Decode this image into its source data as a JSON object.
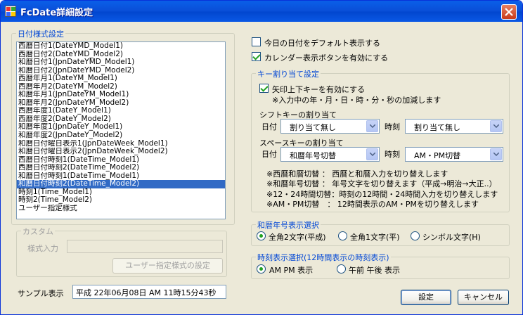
{
  "window": {
    "title": "FcDate詳細設定"
  },
  "format_group": {
    "label": "日付様式設定",
    "items": [
      "西暦日付1(DateYMD_Model1)",
      "西暦日付2(DateYMD_Model2)",
      "和暦日付1(JpnDateYMD_Model1)",
      "和暦日付2(JpnDateYMD_Model2)",
      "西暦年月1(DateYM_Model1)",
      "西暦年月2(DateYM_Model2)",
      "和暦年月1(JpnDateYM_Model1)",
      "和暦年月2(JpnDateYM_Model2)",
      "西暦年度1(DateY_Model1)",
      "西暦年度2(DateY_Model2)",
      "和暦年度1(JpnDateY_Model1)",
      "和暦年度2(JpnDateY_Model2)",
      "和暦日付曜日表示1(JpnDateWeek_Model1)",
      "和暦日付曜日表示2(JpnDateWeek_Model2)",
      "西暦日付時刻1(DateTime_Model1)",
      "西暦日付時刻2(DateTime_Model2)",
      "和暦日付時刻1(DateTime_Model1)",
      "和暦日付時刻2(DateTime_Model2)",
      "時刻1(Time_Model1)",
      "時刻2(Time_Model2)",
      "ユーザー指定様式"
    ],
    "selected_index": 17
  },
  "custom_group": {
    "label": "カスタム",
    "style_input_label": "様式入力",
    "style_input_value": "",
    "user_format_button": "ユーザー指定様式の設定"
  },
  "sample": {
    "label": "サンプル表示",
    "value": "平成 22年06月08日  AM 11時15分43秒"
  },
  "options": {
    "default_today": {
      "label": "今日の日付をデフォルト表示する",
      "checked": false
    },
    "calendar_button": {
      "label": "カレンダー表示ボタンを有効にする",
      "checked": true
    }
  },
  "key_group": {
    "label": "キー割り当て設定",
    "arrow_keys": {
      "label": "矢印上下キーを有効にする",
      "checked": true
    },
    "arrow_note": "※入力中の年・月・日・時・分・秒の加減します",
    "shift_label": "シフトキーの割り当て",
    "space_label": "スペースキーの割り当て",
    "date_label": "日付",
    "time_label": "時刻",
    "shift_date": "割り当て無し",
    "shift_time": "割り当て無し",
    "space_date": "和暦年号切替",
    "space_time": "AM・PM切替",
    "notes": [
      "※西暦和暦切替 ： 西暦と和暦入力を切り替えします",
      "※和暦年号切替 ： 年号文字を切り替えます（平成→明治→大正..）",
      "※12・24時間切替：時刻の12時間・24時間入力を切り替えします",
      "※AM・PM切替　： 12時間表示のAM・PMを切り替えします"
    ]
  },
  "era_group": {
    "label": "和暦年号表示選択",
    "options": [
      "全角2文字(平成)",
      "全角1文字(平)",
      "シンボル文字(H)"
    ],
    "selected": 0
  },
  "time_group": {
    "label": "時刻表示選択(12時間表示の時刻表示)",
    "options": [
      "AM PM 表示",
      "午前 午後 表示"
    ],
    "selected": 0
  },
  "buttons": {
    "ok": "設定",
    "cancel": "キャンセル"
  },
  "colors": {
    "titlebar": "#0a50d9",
    "face": "#ece9d8",
    "group_label": "#0046d5",
    "selection": "#316ac5",
    "close": "#c93a1a"
  }
}
